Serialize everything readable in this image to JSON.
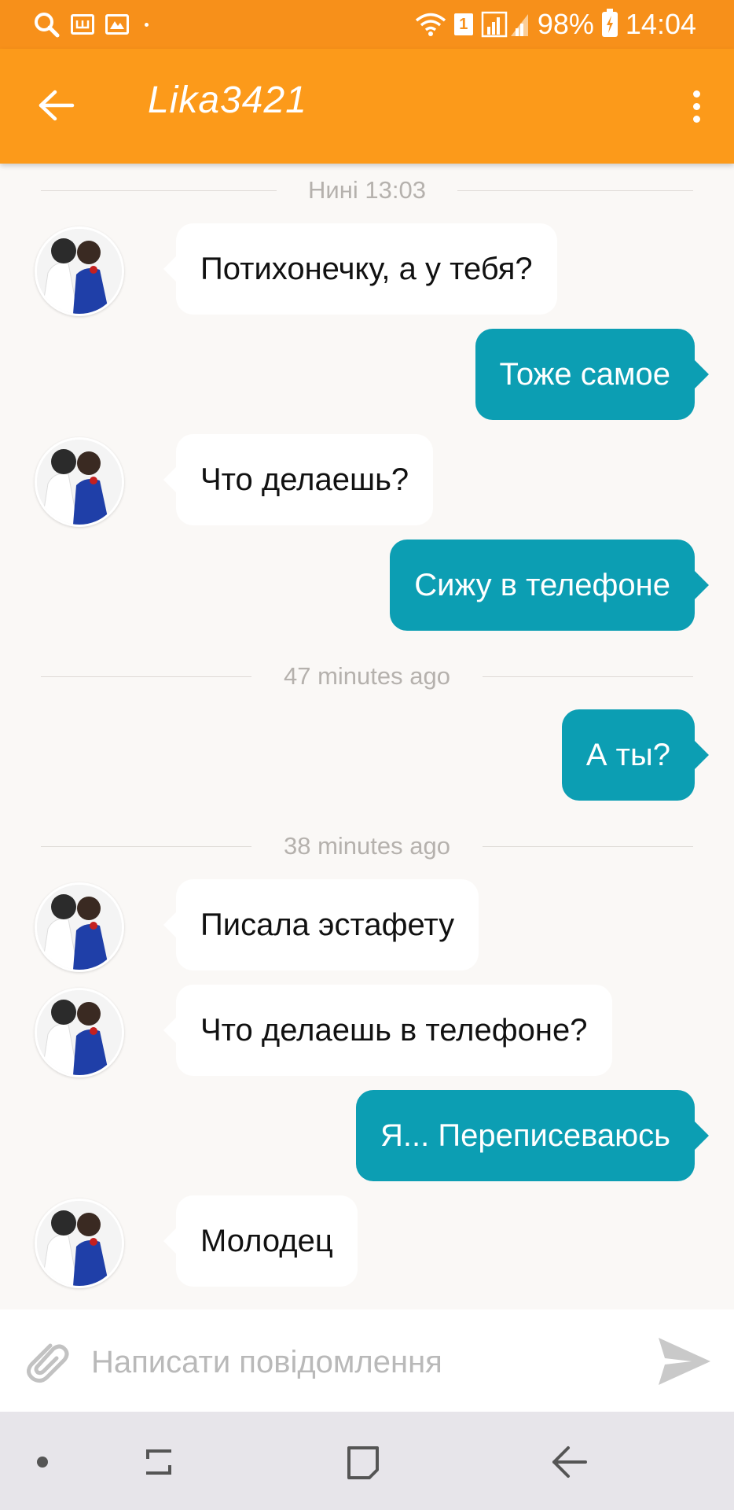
{
  "status_bar": {
    "battery": "98%",
    "time": "14:04",
    "sim_slot": "1",
    "icons": [
      "search-icon",
      "shopping-icon",
      "gallery-icon",
      "dot-icon",
      "wifi-icon",
      "sim-icon",
      "signal-icon",
      "battery-charging-icon"
    ]
  },
  "header": {
    "title": "Lika3421",
    "back_icon": "arrow-left-icon",
    "more_icon": "more-vertical-icon"
  },
  "chat": {
    "separators": [
      "Нині 13:03",
      "47 minutes ago",
      "38 minutes ago"
    ],
    "messages": [
      {
        "from": "them",
        "text": "Потихонечку, а у тебя?"
      },
      {
        "from": "me",
        "text": "Тоже самое"
      },
      {
        "from": "them",
        "text": "Что делаешь?"
      },
      {
        "from": "me",
        "text": "Сижу в телефоне"
      },
      {
        "from": "me",
        "text": "А ты?"
      },
      {
        "from": "them",
        "text": "Писала эстафету"
      },
      {
        "from": "them",
        "text": "Что делаешь в телефоне?"
      },
      {
        "from": "me",
        "text": "Я... Переписеваюсь"
      },
      {
        "from": "them",
        "text": "Молодец"
      }
    ]
  },
  "composer": {
    "placeholder": "Написати повідомлення",
    "value": "",
    "attach_icon": "paperclip-icon",
    "send_icon": "send-icon"
  },
  "navbar": {
    "items": [
      "dot-icon",
      "recent-apps-icon",
      "home-icon",
      "back-icon"
    ]
  },
  "colors": {
    "header": "#fc9a1a",
    "status_bar": "#f7901a",
    "outgoing_bubble": "#0c9eb3",
    "incoming_bubble": "#ffffff",
    "background": "#faf8f6"
  }
}
